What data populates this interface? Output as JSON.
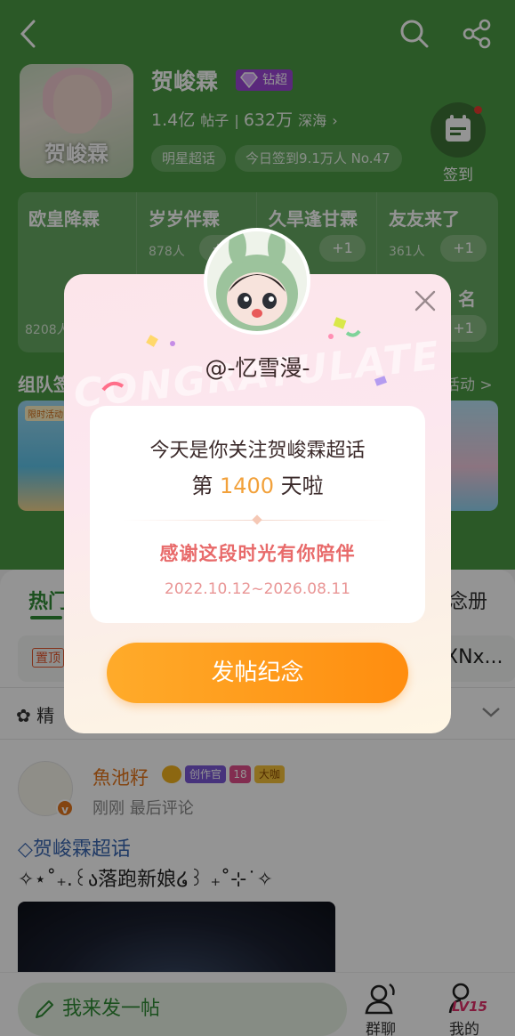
{
  "header": {
    "cover_text": "贺峻霖",
    "title": "贺峻霖",
    "badge": "钻超",
    "stat_posts": "1.4亿",
    "stat_posts_label": "帖子",
    "stat_fans": "632万",
    "stat_fans_label": "深海",
    "chip_category": "明星超话",
    "chip_signin_today": "今日签到9.1万人 No.47",
    "signin_label": "签到"
  },
  "cards": [
    {
      "title": "欧皇降霖",
      "count": "8208人"
    },
    {
      "title": "岁岁伴霖",
      "count": "878人",
      "plus": "+1"
    },
    {
      "title": "久旱逢甘霖",
      "plus": "+1"
    },
    {
      "title": "友友来了",
      "count": "361人",
      "plus": "+1",
      "second_title": "名",
      "second_plus": "+1"
    }
  ],
  "team": {
    "label": "组队签",
    "more": "活动 >",
    "thumb_tag": "限时活动"
  },
  "tabs": {
    "hot": "热门",
    "album": "念册"
  },
  "pinned": {
    "tag": "置顶",
    "right_text": "XNx..."
  },
  "section": {
    "label": "精"
  },
  "post": {
    "username": "魚池籽",
    "badge_creator": "创作官",
    "badge_level": "18",
    "badge_big": "大咖",
    "time": "刚刚 最后评论",
    "topic": "贺峻霖超话",
    "text": "✧⋆˚₊.꒰ა落跑新娘໒꒱ ₊˚⊹˙✧",
    "verified": "v"
  },
  "bottom": {
    "compose": "我来发一帖",
    "nav_group": "群聊",
    "nav_me": "我的",
    "level": "LV15"
  },
  "modal": {
    "watermark": "CONGRATULATE",
    "user": "@-忆雪漫-",
    "line1": "今天是你关注贺峻霖超话",
    "line2_prefix": "第",
    "days": "1400",
    "line2_suffix": "天啦",
    "thanks": "感谢这段时光有你陪伴",
    "dates": "2022.10.12~2026.08.11",
    "cta": "发帖纪念"
  },
  "colors": {
    "brand_green": "#4a9a44",
    "accent_orange": "#ff9a1f",
    "thanks_pink": "#e86a6a"
  }
}
